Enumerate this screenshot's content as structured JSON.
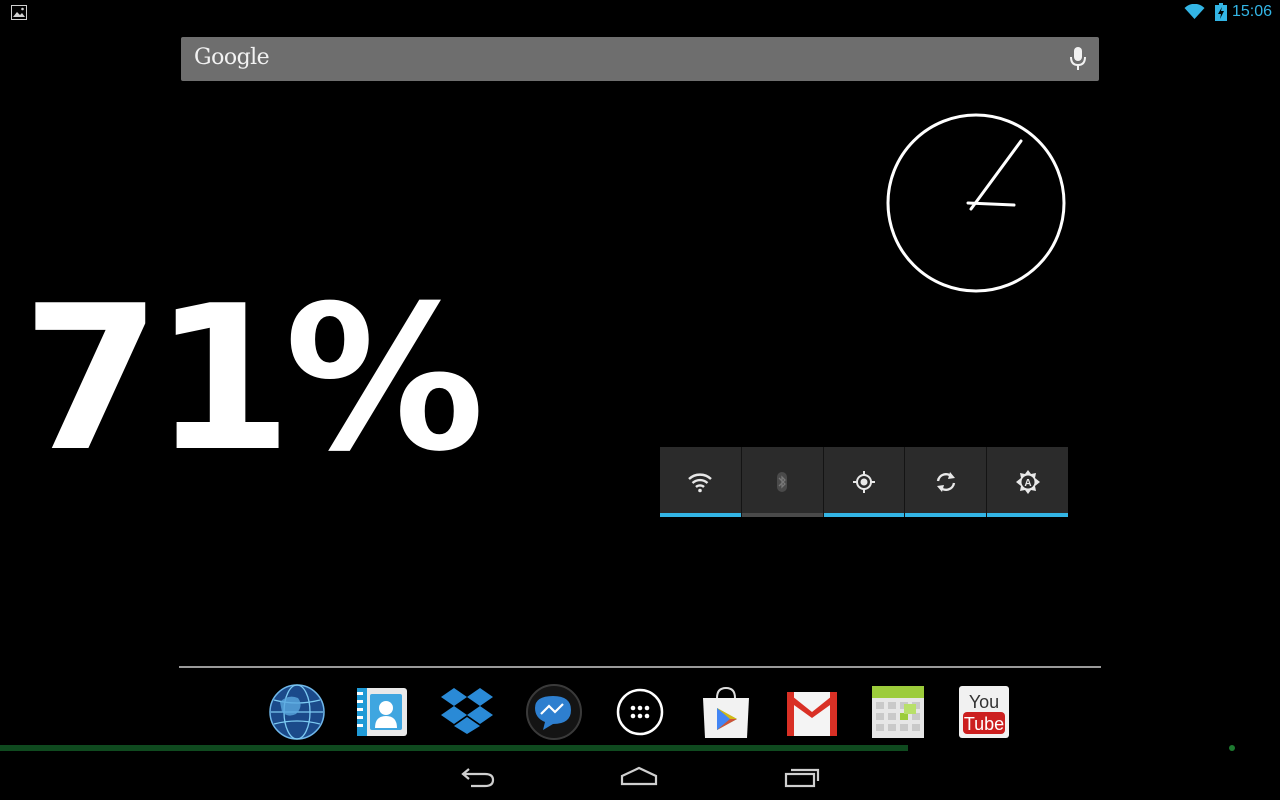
{
  "status_bar": {
    "time": "15:06",
    "icons": [
      "image-notification-icon",
      "wifi-icon",
      "battery-charging-icon"
    ],
    "accent_color": "#33b5e5"
  },
  "search": {
    "logo_text": "Google",
    "mic_icon": "microphone-icon"
  },
  "clock_widget": {
    "type": "analog-clock",
    "hour_hand_minutes_angle": "15:06"
  },
  "battery_widget": {
    "value": "71%"
  },
  "power_control": {
    "buttons": [
      {
        "name": "wifi",
        "icon": "wifi-icon",
        "state": "on"
      },
      {
        "name": "bluetooth",
        "icon": "bluetooth-icon",
        "state": "off"
      },
      {
        "name": "gps",
        "icon": "location-icon",
        "state": "on"
      },
      {
        "name": "sync",
        "icon": "sync-icon",
        "state": "on"
      },
      {
        "name": "brightness",
        "icon": "auto-brightness-icon",
        "state": "on",
        "label": "A"
      }
    ]
  },
  "dock": {
    "apps": [
      {
        "name": "browser",
        "icon": "globe-icon"
      },
      {
        "name": "contacts",
        "icon": "contacts-icon"
      },
      {
        "name": "dropbox",
        "icon": "dropbox-icon"
      },
      {
        "name": "messenger",
        "icon": "messenger-icon"
      },
      {
        "name": "all-apps",
        "icon": "app-drawer-icon"
      },
      {
        "name": "play-store",
        "icon": "play-store-icon"
      },
      {
        "name": "gmail",
        "icon": "gmail-icon"
      },
      {
        "name": "calendar",
        "icon": "calendar-icon"
      },
      {
        "name": "youtube",
        "icon": "youtube-icon",
        "label_top": "You",
        "label_bottom": "Tube"
      }
    ]
  },
  "nav_bar": {
    "buttons": [
      "back-icon",
      "home-icon",
      "recents-icon"
    ]
  }
}
